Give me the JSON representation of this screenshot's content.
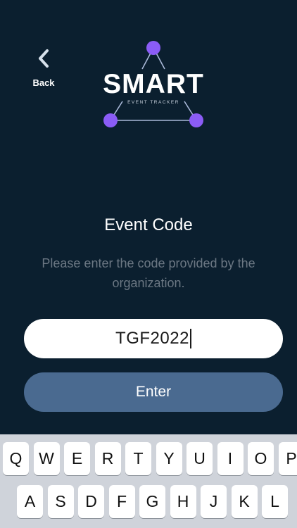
{
  "header": {
    "back_label": "Back",
    "back_icon": "chevron-left-icon"
  },
  "logo": {
    "word": "SMART",
    "tagline": "EVENT TRACKER",
    "accent_color": "#8b5cf6"
  },
  "main": {
    "title": "Event Code",
    "description": "Please enter the code provided by the organization.",
    "input_value": "TGF2022",
    "enter_label": "Enter"
  },
  "keyboard": {
    "row1": [
      "Q",
      "W",
      "E",
      "R",
      "T",
      "Y",
      "U",
      "I",
      "O",
      "P"
    ],
    "row2": [
      "A",
      "S",
      "D",
      "F",
      "G",
      "H",
      "J",
      "K",
      "L"
    ]
  },
  "colors": {
    "background": "#0b1f2f",
    "button": "#4a6a90",
    "description": "#6b7783"
  }
}
